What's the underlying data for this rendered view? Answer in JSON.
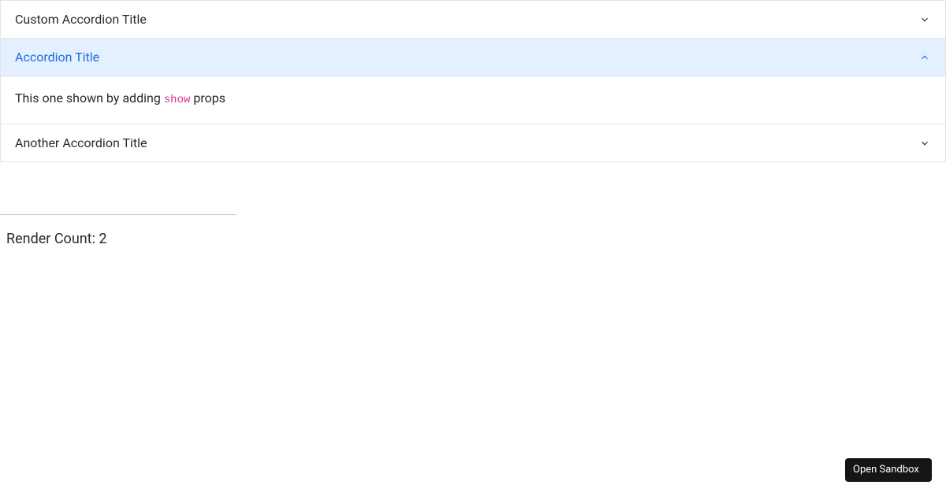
{
  "accordion": {
    "items": [
      {
        "title": "Custom Accordion Title",
        "expanded": false
      },
      {
        "title": "Accordion Title",
        "expanded": true,
        "body_prefix": "This one shown by adding ",
        "body_code": "show",
        "body_suffix": " props"
      },
      {
        "title": "Another Accordion Title",
        "expanded": false
      }
    ]
  },
  "render_count_label": "Render Count: ",
  "render_count_value": "2",
  "sandbox_button": "Open Sandbox"
}
